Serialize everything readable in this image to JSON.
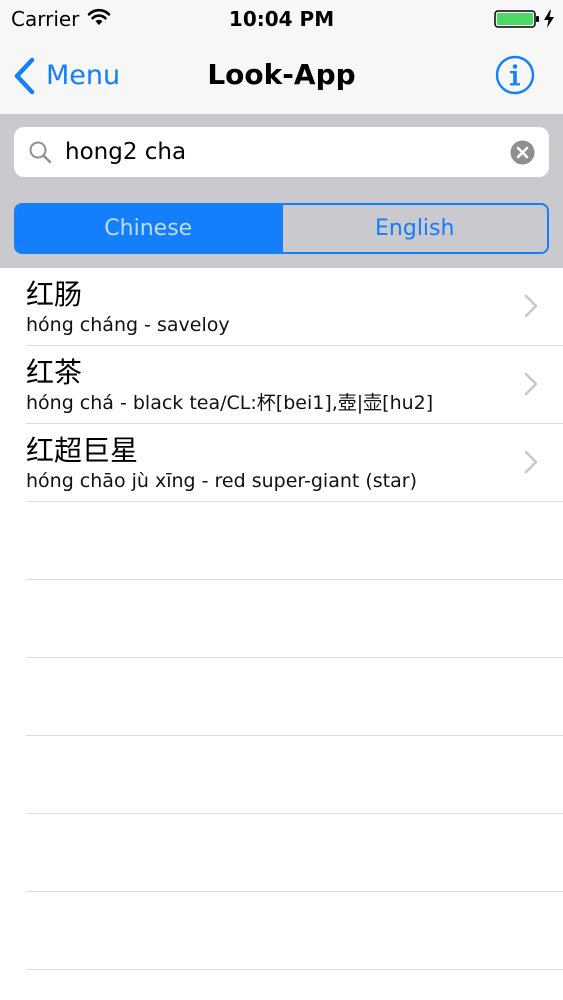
{
  "status_bar": {
    "carrier": "Carrier",
    "time": "10:04 PM",
    "battery_color": "#4cd964"
  },
  "nav": {
    "back_label": "Menu",
    "title": "Look-App",
    "accent_color": "#147efb",
    "info_icon": "info-icon"
  },
  "search": {
    "value": "hong2 cha",
    "placeholder": ""
  },
  "segments": {
    "items": [
      "Chinese",
      "English"
    ],
    "selected": "Chinese"
  },
  "results": [
    {
      "hanzi": "红肠",
      "definition": "hóng cháng - saveloy"
    },
    {
      "hanzi": "红茶",
      "definition": "hóng chá - black tea/CL:杯[bei1],壺|壶[hu2]"
    },
    {
      "hanzi": "红超巨星",
      "definition": "hóng chāo jù xīng - red super-giant (star)"
    }
  ]
}
